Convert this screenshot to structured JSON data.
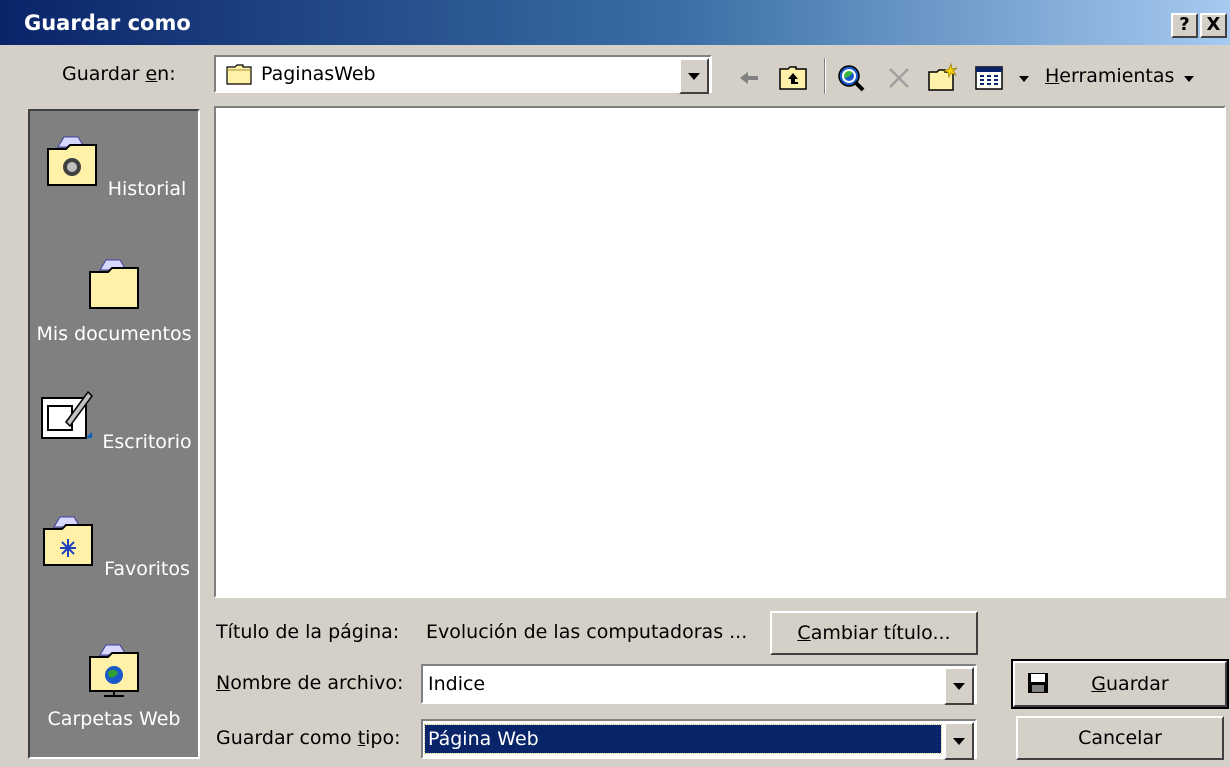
{
  "window": {
    "title": "Guardar como",
    "help_btn": "?",
    "close_btn": "X"
  },
  "toolbar": {
    "save_in_label_pre": "Guardar ",
    "save_in_label_accel": "e",
    "save_in_label_post": "n:",
    "location_value": "PaginasWeb",
    "tools_accel": "H",
    "tools_label_rest": "erramientas"
  },
  "places": [
    {
      "label": "Historial",
      "icon": "history-folder-icon"
    },
    {
      "label": "Mis documentos",
      "icon": "documents-folder-icon"
    },
    {
      "label": "Escritorio",
      "icon": "desktop-icon"
    },
    {
      "label": "Favoritos",
      "icon": "favorites-folder-icon"
    },
    {
      "label": "Carpetas Web",
      "icon": "web-folders-icon"
    }
  ],
  "form": {
    "page_title_label": "Título de la página:",
    "page_title_value": "Evolución de las computadoras ...",
    "change_title_accel": "C",
    "change_title_rest": "ambiar título...",
    "filename_accel": "N",
    "filename_label_rest": "ombre de archivo:",
    "filename_value": "Indice",
    "type_label_pre": "Guardar como ",
    "type_label_accel": "t",
    "type_label_post": "ipo:",
    "type_value": "Página Web"
  },
  "buttons": {
    "save_accel": "G",
    "save_rest": "uardar",
    "cancel": "Cancelar"
  },
  "colors": {
    "titlebar_start": "#0a246a",
    "titlebar_end": "#a6caf0",
    "face": "#d4d0c8",
    "selection": "#0a246a"
  }
}
